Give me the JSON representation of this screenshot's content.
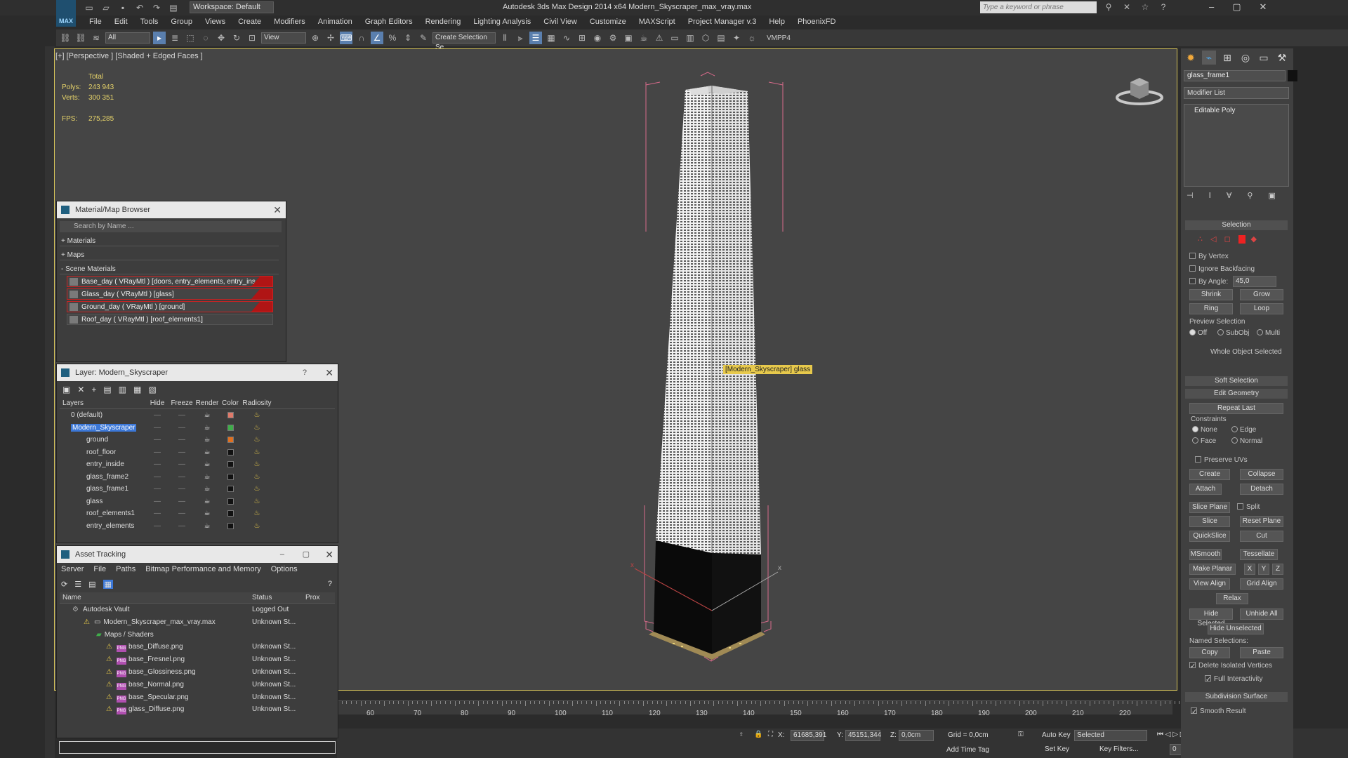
{
  "window": {
    "title": "Autodesk 3ds Max Design 2014 x64     Modern_Skyscraper_max_vray.max",
    "workspace": "Workspace: Default",
    "search_placeholder": "Type a keyword or phrase"
  },
  "menu": [
    "File",
    "Edit",
    "Tools",
    "Group",
    "Views",
    "Create",
    "Modifiers",
    "Animation",
    "Graph Editors",
    "Rendering",
    "Lighting Analysis",
    "Civil View",
    "Customize",
    "MAXScript",
    "Project Manager v.3",
    "Help",
    "PhoenixFD"
  ],
  "toolbar": {
    "filter": "All",
    "ref_coord": "View",
    "selection_set": "Create Selection Se",
    "plugin": "VMPP4"
  },
  "viewport": {
    "label": "[+] [Perspective ] [Shaded + Edged Faces ]",
    "stats": {
      "header": "Total",
      "polys_label": "Polys:",
      "polys": "243 943",
      "verts_label": "Verts:",
      "verts": "300 351",
      "fps_label": "FPS:",
      "fps": "275,285"
    },
    "tooltip": "[Modern_Skyscraper] glass"
  },
  "material_browser": {
    "title": "Material/Map Browser",
    "search": "Search by Name ...",
    "categories": [
      "+ Materials",
      "+ Maps",
      "- Scene Materials"
    ],
    "items": [
      {
        "label": "Base_day  ( VRayMtl ) [doors, entry_elements, entry_ins..."
      },
      {
        "label": "Glass_day  ( VRayMtl ) [glass]"
      },
      {
        "label": "Ground_day  ( VRayMtl ) [ground]"
      },
      {
        "label": "Roof_day  ( VRayMtl ) [roof_elements1]"
      }
    ]
  },
  "layer_manager": {
    "title": "Layer: Modern_Skyscraper",
    "help": "?",
    "columns": [
      "Layers",
      "Hide",
      "Freeze",
      "Render",
      "Color",
      "Radiosity"
    ],
    "rows": [
      {
        "name": "0 (default)",
        "color": "#e07a6a"
      },
      {
        "name": "Modern_Skyscraper",
        "color": "#3fae4a"
      },
      {
        "name": "ground",
        "color": "#e07020"
      },
      {
        "name": "roof_floor",
        "color": "#111111"
      },
      {
        "name": "entry_inside",
        "color": "#111111"
      },
      {
        "name": "glass_frame2",
        "color": "#111111"
      },
      {
        "name": "glass_frame1",
        "color": "#111111"
      },
      {
        "name": "glass",
        "color": "#111111"
      },
      {
        "name": "roof_elements1",
        "color": "#111111"
      },
      {
        "name": "entry_elements",
        "color": "#111111"
      }
    ]
  },
  "asset_tracking": {
    "title": "Asset Tracking",
    "menu": [
      "Server",
      "File",
      "Paths",
      "Bitmap Performance and Memory",
      "Options"
    ],
    "columns": [
      "Name",
      "Status",
      "Prox"
    ],
    "rows": [
      {
        "name": "Autodesk Vault",
        "status": "Logged Out"
      },
      {
        "name": "Modern_Skyscraper_max_vray.max",
        "status": "Unknown St..."
      },
      {
        "name": "Maps / Shaders",
        "status": ""
      },
      {
        "name": "base_Diffuse.png",
        "status": "Unknown St..."
      },
      {
        "name": "base_Fresnel.png",
        "status": "Unknown St..."
      },
      {
        "name": "base_Glossiness.png",
        "status": "Unknown St..."
      },
      {
        "name": "base_Normal.png",
        "status": "Unknown St..."
      },
      {
        "name": "base_Specular.png",
        "status": "Unknown St..."
      },
      {
        "name": "glass_Diffuse.png",
        "status": "Unknown St..."
      }
    ]
  },
  "command_panel": {
    "object_name": "glass_frame1",
    "modifier_list": "Modifier List",
    "stack_item": "Editable Poly",
    "selection": {
      "title": "Selection",
      "by_vertex": "By Vertex",
      "ignore_backfacing": "Ignore Backfacing",
      "by_angle": "By Angle:",
      "angle": "45,0",
      "shrink": "Shrink",
      "grow": "Grow",
      "ring": "Ring",
      "loop": "Loop",
      "preview": "Preview Selection",
      "preview_off": "Off",
      "preview_subobj": "SubObj",
      "preview_multi": "Multi",
      "status": "Whole Object Selected"
    },
    "soft_selection": "Soft Selection",
    "edit_geometry": {
      "title": "Edit Geometry",
      "repeat_last": "Repeat Last",
      "constraints": "Constraints",
      "none": "None",
      "edge": "Edge",
      "face": "Face",
      "normal": "Normal",
      "preserve_uvs": "Preserve UVs",
      "create": "Create",
      "collapse": "Collapse",
      "attach": "Attach",
      "detach": "Detach",
      "slice_plane": "Slice Plane",
      "split": "Split",
      "slice": "Slice",
      "reset_plane": "Reset Plane",
      "quickslice": "QuickSlice",
      "cut": "Cut",
      "msmooth": "MSmooth",
      "tessellate": "Tessellate",
      "make_planar": "Make Planar",
      "x": "X",
      "y": "Y",
      "z": "Z",
      "view_align": "View Align",
      "grid_align": "Grid Align",
      "relax": "Relax",
      "hide_selected": "Hide Selected",
      "unhide_all": "Unhide All",
      "hide_unselected": "Hide Unselected",
      "named_selections": "Named Selections:",
      "copy": "Copy",
      "paste": "Paste",
      "delete_isolated": "Delete Isolated Vertices",
      "full_interactivity": "Full Interactivity"
    },
    "subdivision": {
      "title": "Subdivision Surface",
      "smooth_result": "Smooth Result"
    }
  },
  "timeline": {
    "ticks": [
      "60",
      "70",
      "80",
      "90",
      "100",
      "110",
      "120",
      "130",
      "140",
      "150",
      "160",
      "170",
      "180",
      "190",
      "200",
      "210",
      "220"
    ]
  },
  "statusbar": {
    "x_label": "X:",
    "x": "61685,391",
    "y_label": "Y:",
    "y": "45151,344",
    "z_label": "Z:",
    "z": "0,0cm",
    "grid": "Grid = 0,0cm",
    "auto_key": "Auto Key",
    "key_mode": "Selected",
    "set_key": "Set Key",
    "key_filters": "Key Filters...",
    "add_time_tag": "Add Time Tag",
    "frame": "0"
  }
}
